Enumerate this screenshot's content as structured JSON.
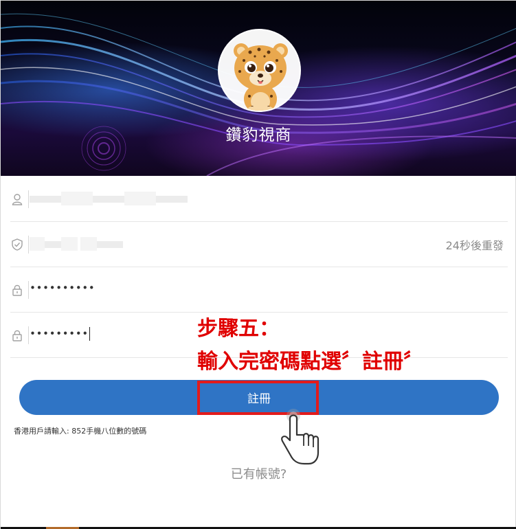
{
  "header": {
    "brand_name": "鑽豹視商",
    "logo_icon": "leopard-logo-icon"
  },
  "form": {
    "phone": {
      "icon": "user-icon",
      "value_masked": true
    },
    "verify_code": {
      "icon": "shield-check-icon",
      "value_masked": true,
      "resend_label": "24秒後重發"
    },
    "password": {
      "icon": "lock-icon",
      "value": "••••••••••"
    },
    "confirm_password": {
      "icon": "lock-icon",
      "value": "•••••••••"
    }
  },
  "annotation": {
    "line1": "步驟五：",
    "line2": "輸入完密碼點選〞註冊〞",
    "color": "#e00000"
  },
  "register_button": {
    "label": "註冊",
    "color": "#2f74c5"
  },
  "hint": "香港用戶請輸入: 852手機八位數的號碼",
  "login_link": "已有帳號?",
  "pointer_icon": "hand-pointer-icon"
}
